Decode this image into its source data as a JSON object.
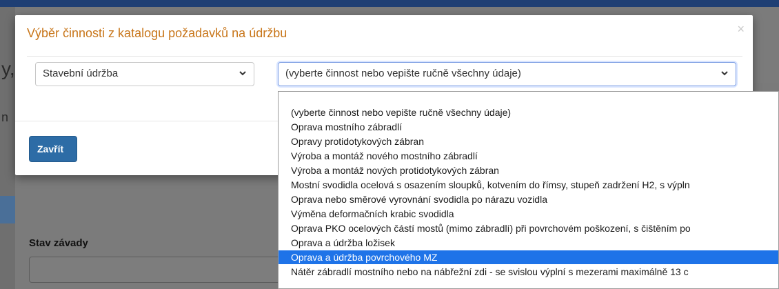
{
  "modal": {
    "title": "Výběr činnosti z katalogu požadavků na údržbu",
    "close_symbol": "×",
    "category_select_value": "Stavební údržba",
    "activity_select_value": "(vyberte činnost nebo vepište ručně všechny údaje)",
    "close_button_label": "Zavřít"
  },
  "background": {
    "field_label": "Stav závady",
    "side_glyph_1": "y,",
    "side_glyph_2": "n"
  },
  "dropdown": {
    "options": [
      "(vyberte činnost nebo vepište ručně všechny údaje)",
      "Oprava mostního zábradlí",
      "Opravy protidotykových zábran",
      "Výroba a montáž nového mostního zábradlí",
      "Výroba a montáž nových protidotykových zábran",
      "Mostní svodidla ocelová s osazením sloupků, kotvením do římsy, stupeň zadržení H2, s výpln",
      "Oprava nebo směrové vyrovnání svodidla po nárazu vozidla",
      "Výměna deformačních krabic svodidla",
      "Oprava PKO ocelových částí mostů (mimo zábradlí) při povrchovém poškození, s čištěním po",
      "Oprava a údržba ložisek",
      "Oprava a údržba povrchového MZ",
      "Nátěr zábradlí mostního nebo na nábřežní zdi - se svislou výplní s mezerami maximálně 13 c"
    ],
    "selected_index": 10
  },
  "colors": {
    "title": "#c8761a",
    "primary_button": "#2d6ca6",
    "selected_option": "#1e73e8",
    "topbar": "#1f3f74"
  },
  "icons": {
    "close": "close-icon",
    "select_chevron": "chevron-down-icon"
  }
}
